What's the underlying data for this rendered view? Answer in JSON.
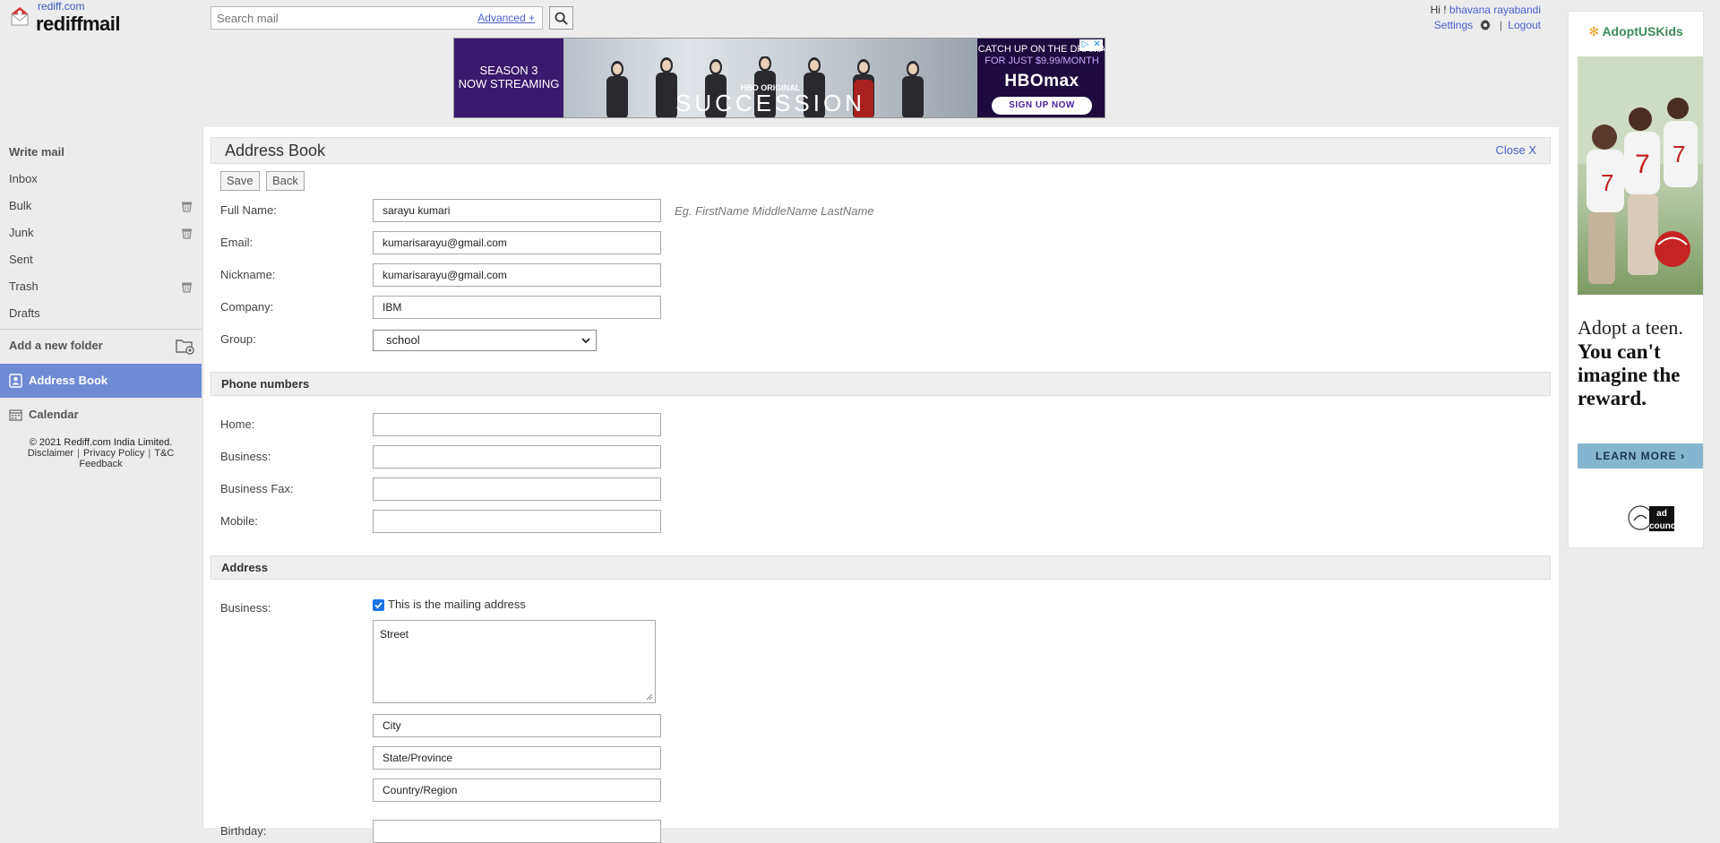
{
  "header": {
    "logo_small": "rediff.com",
    "logo_big": "rediffmail",
    "search_placeholder": "Search mail",
    "advanced_link": "Advanced +",
    "greeting": "Hi !",
    "user_name": "bhavana rayabandi",
    "settings_link": "Settings",
    "logout_link": "Logout"
  },
  "top_ad": {
    "left_text_1": "SEASON 3",
    "left_text_2": "NOW STREAMING",
    "hbo_original": "HBO ORIGINAL",
    "title": "SUCCESSION",
    "catch_line_1": "CATCH UP ON THE DRAMA",
    "catch_line_2": "FOR JUST $9.99/MONTH",
    "brand": "HBOmax",
    "cta": "SIGN UP NOW"
  },
  "sidebar": {
    "write_mail": "Write mail",
    "items": [
      {
        "label": "Inbox",
        "has_trash": false
      },
      {
        "label": "Bulk",
        "has_trash": true
      },
      {
        "label": "Junk",
        "has_trash": true
      },
      {
        "label": "Sent",
        "has_trash": false
      },
      {
        "label": "Trash",
        "has_trash": true
      },
      {
        "label": "Drafts",
        "has_trash": false
      }
    ],
    "add_folder": "Add a new folder",
    "address_book": "Address Book",
    "calendar": "Calendar",
    "copyright": "© 2021 Rediff.com India Limited.",
    "disclaimer": "Disclaimer",
    "privacy": "Privacy Policy",
    "tandc": "T&C",
    "feedback": "Feedback"
  },
  "main": {
    "title": "Address Book",
    "close_link": "Close X",
    "save_btn": "Save",
    "back_btn": "Back",
    "full_name_label": "Full Name:",
    "full_name_value": "sarayu kumari",
    "full_name_hint": "Eg. FirstName MiddleName LastName",
    "email_label": "Email:",
    "email_value": "kumarisarayu@gmail.com",
    "nickname_label": "Nickname:",
    "nickname_value": "kumarisarayu@gmail.com",
    "company_label": "Company:",
    "company_value": "IBM",
    "group_label": "Group:",
    "group_value": "school",
    "phone_section": "Phone numbers",
    "home_label": "Home:",
    "business_label": "Business:",
    "business_fax_label": "Business Fax:",
    "mobile_label": "Mobile:",
    "address_section": "Address",
    "address_business_label": "Business:",
    "mailing_checkbox_label": "This is the mailing address",
    "mailing_checked": true,
    "street_value": "Street",
    "city_value": "City",
    "state_value": "State/Province",
    "country_value": "Country/Region",
    "birthday_label": "Birthday:"
  },
  "side_ad": {
    "brand": "AdoptUSKids",
    "tag1": "Adopt a teen.",
    "tag2": "You can't imagine the reward.",
    "cta": "LEARN MORE",
    "adc_logo": "ad council"
  },
  "colors": {
    "link": "#4a5fcf",
    "active_sidebar": "#6e8bd4",
    "section_bar": "#efefef"
  }
}
